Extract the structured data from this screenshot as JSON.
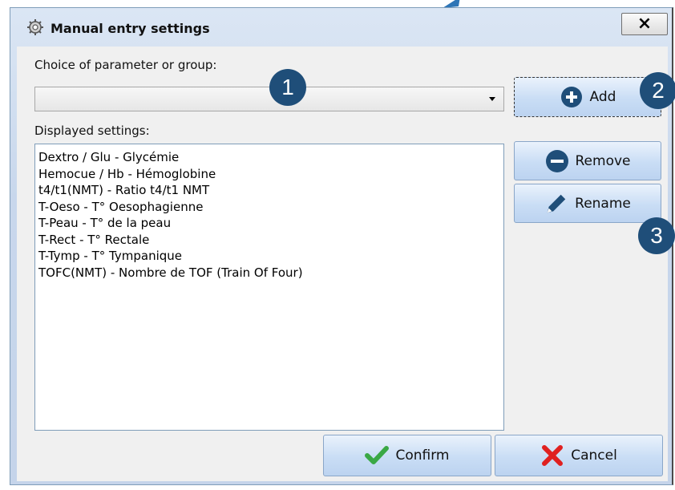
{
  "window": {
    "title": "Manual entry settings",
    "close_symbol": "×"
  },
  "choice": {
    "label": "Choice of parameter or group:",
    "value": ""
  },
  "displayed": {
    "label": "Displayed settings:",
    "items": [
      "Dextro / Glu - Glycémie",
      "Hemocue / Hb - Hémoglobine",
      "t4/t1(NMT) - Ratio t4/t1 NMT",
      "T-Oeso - T° Oesophagienne",
      "T-Peau - T° de la peau",
      "T-Rect - T° Rectale",
      "T-Tymp - T° Tympanique",
      "TOFC(NMT) - Nombre de TOF (Train Of Four)"
    ]
  },
  "buttons": {
    "add": "Add",
    "remove": "Remove",
    "rename": "Rename",
    "confirm": "Confirm",
    "cancel": "Cancel"
  },
  "callouts": [
    "1",
    "2",
    "3"
  ],
  "colors": {
    "badge": "#1f4e79",
    "accent_arrow": "#2e75b6",
    "confirm_check": "#3aa845",
    "cancel_x": "#e02020"
  }
}
